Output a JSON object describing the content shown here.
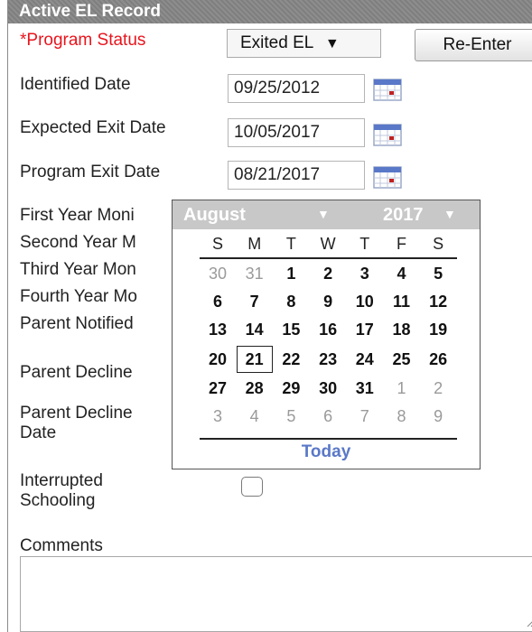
{
  "panel": {
    "title": "Active EL Record"
  },
  "program_status": {
    "label": "*Program Status",
    "value": "Exited EL",
    "dropdown_arrow": "▼"
  },
  "reenter_button": {
    "label": "Re-Enter"
  },
  "identified_date": {
    "label": "Identified Date",
    "value": "09/25/2012"
  },
  "expected_exit_date": {
    "label": "Expected Exit Date",
    "value": "10/05/2017"
  },
  "program_exit_date": {
    "label": "Program Exit Date",
    "value": "08/21/2017"
  },
  "fields": [
    {
      "label": "First Year Moni"
    },
    {
      "label": "Second Year M"
    },
    {
      "label": "Third Year Mon"
    },
    {
      "label": "Fourth Year Mo"
    },
    {
      "label": "Parent Notified"
    },
    {
      "label": "Parent Decline"
    },
    {
      "label_line1": "Parent Decline",
      "label_line2": "Date"
    }
  ],
  "interrupted_schooling": {
    "label_line1": "Interrupted",
    "label_line2": "Schooling",
    "checked": false
  },
  "comments": {
    "label": "Comments",
    "value": ""
  },
  "calendar": {
    "month": "August",
    "year": "2017",
    "arrow": "▼",
    "weekdays": [
      "S",
      "M",
      "T",
      "W",
      "T",
      "F",
      "S"
    ],
    "weeks": [
      [
        {
          "d": "30",
          "m": "other"
        },
        {
          "d": "31",
          "m": "other"
        },
        {
          "d": "1",
          "m": "cur"
        },
        {
          "d": "2",
          "m": "cur"
        },
        {
          "d": "3",
          "m": "cur"
        },
        {
          "d": "4",
          "m": "cur"
        },
        {
          "d": "5",
          "m": "cur"
        }
      ],
      [
        {
          "d": "6",
          "m": "cur"
        },
        {
          "d": "7",
          "m": "cur"
        },
        {
          "d": "8",
          "m": "cur"
        },
        {
          "d": "9",
          "m": "cur"
        },
        {
          "d": "10",
          "m": "cur"
        },
        {
          "d": "11",
          "m": "cur"
        },
        {
          "d": "12",
          "m": "cur"
        }
      ],
      [
        {
          "d": "13",
          "m": "cur"
        },
        {
          "d": "14",
          "m": "cur"
        },
        {
          "d": "15",
          "m": "cur"
        },
        {
          "d": "16",
          "m": "cur"
        },
        {
          "d": "17",
          "m": "cur"
        },
        {
          "d": "18",
          "m": "cur"
        },
        {
          "d": "19",
          "m": "cur"
        }
      ],
      [
        {
          "d": "20",
          "m": "cur"
        },
        {
          "d": "21",
          "m": "cur",
          "selected": true
        },
        {
          "d": "22",
          "m": "cur"
        },
        {
          "d": "23",
          "m": "cur"
        },
        {
          "d": "24",
          "m": "cur"
        },
        {
          "d": "25",
          "m": "cur"
        },
        {
          "d": "26",
          "m": "cur"
        }
      ],
      [
        {
          "d": "27",
          "m": "cur"
        },
        {
          "d": "28",
          "m": "cur"
        },
        {
          "d": "29",
          "m": "cur"
        },
        {
          "d": "30",
          "m": "cur"
        },
        {
          "d": "31",
          "m": "cur"
        },
        {
          "d": "1",
          "m": "other"
        },
        {
          "d": "2",
          "m": "other"
        }
      ],
      [
        {
          "d": "3",
          "m": "other"
        },
        {
          "d": "4",
          "m": "other"
        },
        {
          "d": "5",
          "m": "other"
        },
        {
          "d": "6",
          "m": "other"
        },
        {
          "d": "7",
          "m": "other"
        },
        {
          "d": "8",
          "m": "other"
        },
        {
          "d": "9",
          "m": "other"
        }
      ]
    ],
    "today_label": "Today"
  },
  "colors": {
    "required_label": "#e8141c",
    "header_bg": "#8a8a8a",
    "calendar_header_bg": "#c8c8c8",
    "today_link": "#5a78c8",
    "other_month_day": "#9a9a9a"
  },
  "icons": {
    "calendar": "calendar-icon",
    "dropdown": "chevron-down-icon",
    "resize": "resize-grip-icon"
  }
}
